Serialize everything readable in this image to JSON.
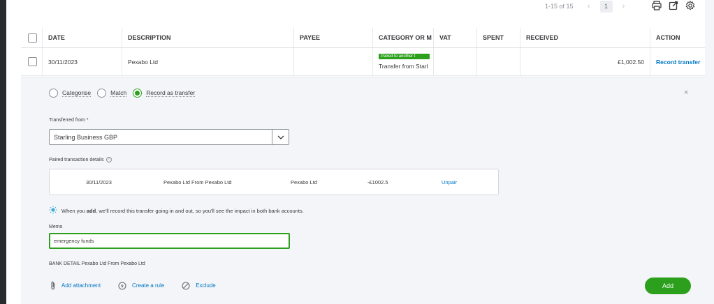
{
  "pagination": {
    "count": "1-15 of 15",
    "current_page": "1",
    "prev": "‹",
    "next": "›"
  },
  "toolbar": {
    "print_icon": "print-icon",
    "export_icon": "export-icon",
    "settings_icon": "gear-icon"
  },
  "table": {
    "columns": [
      "DATE",
      "DESCRIPTION",
      "PAYEE",
      "CATEGORY OR M",
      "VAT",
      "SPENT",
      "RECEIVED",
      "ACTION"
    ],
    "row": {
      "date": "30/11/2023",
      "description": "Pexabo Ltd",
      "payee": "",
      "category_badge": "Paired to another t",
      "category": "Transfer from Starl",
      "vat": "",
      "spent": "",
      "received": "£1,002.50",
      "action": "Record transfer"
    }
  },
  "panel": {
    "radios": [
      {
        "label": "Categorise",
        "checked": false
      },
      {
        "label": "Match",
        "checked": false
      },
      {
        "label": "Record as transfer",
        "checked": true
      }
    ],
    "close": "×",
    "transferred_from_label": "Transferred from *",
    "transferred_from_value": "Starling Business GBP",
    "paired_label": "Paired transaction details",
    "paired_help": "?",
    "paired": {
      "date": "30/11/2023",
      "description": "Pexabo Ltd From Pexabo Ltd",
      "payee": "Pexabo Ltd",
      "amount": "-£1002.5",
      "unpair": "Unpair"
    },
    "info_pre": "When you ",
    "info_bold": "add",
    "info_post": ", we'll record this transfer going in and out, so you'll see the impact in both bank accounts.",
    "memo_label": "Memo",
    "memo_value": "emergency funds",
    "bank_detail": "BANK DETAIL Pexabo Ltd From Pexabo Ltd",
    "actions": {
      "attachment": "Add attachment",
      "rule": "Create a rule",
      "exclude": "Exclude"
    },
    "add_button": "Add"
  },
  "colors": {
    "accent_green": "#2ca01c",
    "link_blue": "#0077c5",
    "panel_bg": "#f4f5f8"
  }
}
